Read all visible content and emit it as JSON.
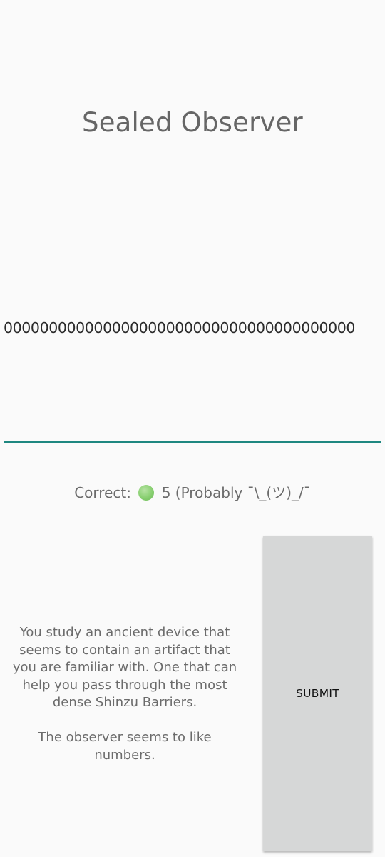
{
  "title": "Sealed Observer",
  "number_input": {
    "value": "000000000000000000000000000000000000000"
  },
  "status": {
    "correct_label": "Correct:",
    "indicator_icon": "green-circle-icon",
    "indicator_color": "#88cf70",
    "correct_value": "5 (Probably ¯\\_(ツ)_/¯"
  },
  "description": {
    "paragraph1": "You study an ancient device that seems to contain an artifact that you are familiar with. One that can help you pass through the most dense Shinzu Barriers.",
    "paragraph2": "The observer seems to like numbers."
  },
  "submit": {
    "label": "SUBMIT"
  },
  "colors": {
    "accent": "#1e8780",
    "button_bg": "#d6d7d7",
    "background": "#fafafa"
  }
}
